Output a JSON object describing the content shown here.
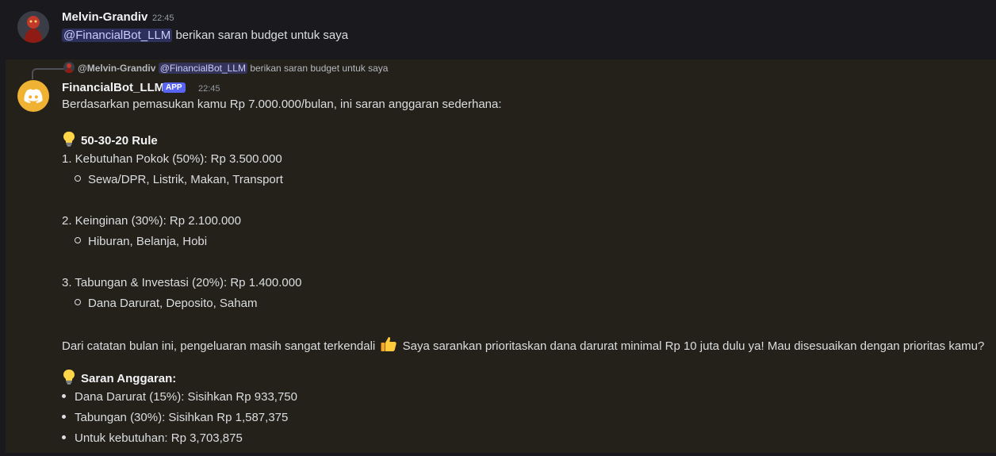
{
  "user_message": {
    "author": "Melvin-Grandiv",
    "timestamp": "22:45",
    "mention": "@FinancialBot_LLM",
    "text": "berikan saran budget untuk saya"
  },
  "bot_message": {
    "reply": {
      "author": "@Melvin-Grandiv",
      "mention": "@FinancialBot_LLM",
      "text": "berikan saran budget untuk saya"
    },
    "author": "FinancialBot_LLM",
    "badge": "APP",
    "timestamp": "22:45",
    "intro": "Berdasarkan pemasukan kamu Rp 7.000.000/bulan, ini saran anggaran sederhana:",
    "rule_heading": "50-30-20 Rule",
    "items": [
      {
        "label": "1. Kebutuhan Pokok (50%): Rp 3.500.000",
        "sub": "Sewa/DPR, Listrik, Makan, Transport"
      },
      {
        "label": "2. Keinginan (30%): Rp 2.100.000",
        "sub": "Hiburan, Belanja, Hobi"
      },
      {
        "label": "3. Tabungan & Investasi (20%): Rp 1.400.000",
        "sub": "Dana Darurat, Deposito, Saham"
      }
    ],
    "note_before": "Dari catatan bulan ini, pengeluaran masih sangat terkendali",
    "note_after": "Saya sarankan prioritaskan dana darurat minimal Rp 10 juta dulu ya! Mau disesuaikan dengan prioritas kamu?",
    "saran_heading": "Saran Anggaran:",
    "saran_items": [
      "Dana Darurat (15%): Sisihkan Rp 933,750",
      "Tabungan (30%): Sisihkan Rp 1,587,375",
      "Untuk kebutuhan: Rp 3,703,875"
    ]
  },
  "colors": {
    "mention_bg": "#3c4270",
    "app_badge": "#5865f2",
    "bot_avatar": "#f0b232",
    "bot_message_bg": "#24201a"
  },
  "icons": [
    "user-avatar-icon",
    "discord-logo-icon",
    "lightbulb-icon",
    "thumbs-up-icon"
  ]
}
